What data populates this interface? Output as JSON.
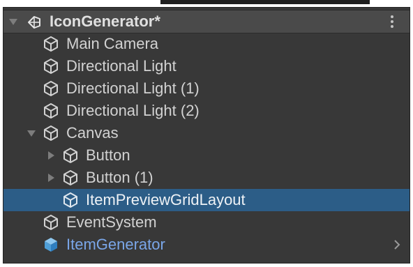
{
  "scene": {
    "name": "IconGenerator*",
    "icon": "unity-scene-icon",
    "menu_icon": "kebab-menu-icon"
  },
  "hierarchy": {
    "items": [
      {
        "label": "Main Camera",
        "icon": "gameobject-cube-icon"
      },
      {
        "label": "Directional Light",
        "icon": "gameobject-cube-icon"
      },
      {
        "label": "Directional Light (1)",
        "icon": "gameobject-cube-icon"
      },
      {
        "label": "Directional Light (2)",
        "icon": "gameobject-cube-icon"
      },
      {
        "label": "Canvas",
        "icon": "gameobject-cube-icon",
        "expanded": true
      },
      {
        "label": "Button",
        "icon": "gameobject-cube-icon",
        "expanded": false
      },
      {
        "label": "Button (1)",
        "icon": "gameobject-cube-icon",
        "expanded": false
      },
      {
        "label": "ItemPreviewGridLayout",
        "icon": "gameobject-cube-icon",
        "selected": true
      },
      {
        "label": "EventSystem",
        "icon": "gameobject-cube-icon"
      },
      {
        "label": "ItemGenerator",
        "icon": "prefab-cube-icon",
        "prefab": true
      }
    ]
  },
  "colors": {
    "panel_background": "#383838",
    "scene_header": "#4a4a4a",
    "selection": "#2c5d87",
    "text": "#d2d2d2",
    "prefab_text": "#7aa6e8"
  }
}
